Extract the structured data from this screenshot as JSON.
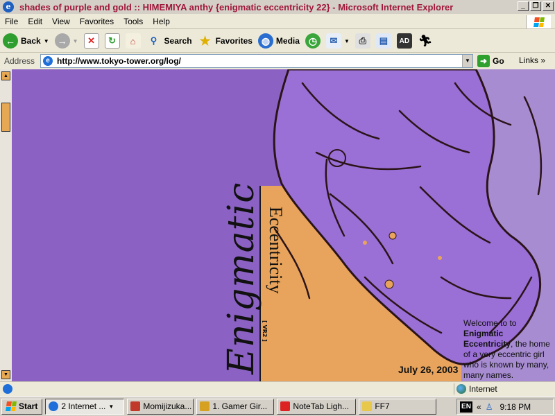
{
  "window": {
    "title": "shades of purple and gold   ::   HIMEMIYA anthy    {enigmatic eccentricity 22} - Microsoft Internet Explorer",
    "controls": [
      "_",
      "❐",
      "✕"
    ]
  },
  "menu": [
    "File",
    "Edit",
    "View",
    "Favorites",
    "Tools",
    "Help"
  ],
  "toolbar": {
    "back_label": "Back",
    "search_label": "Search",
    "favorites_label": "Favorites",
    "media_label": "Media"
  },
  "address": {
    "label": "Address",
    "url": "http://www.tokyo-tower.org/log/",
    "go_label": "Go",
    "links_label": "Links"
  },
  "page": {
    "title_main": "Enigmatic",
    "title_sub": "Eccentricity",
    "version": "[ VR2 ]",
    "date": "July 26, 2003",
    "welcome_intro": "Welcome to to",
    "welcome_name": "Enigmatic Eccentricity",
    "welcome_rest": ", the home of a very eccentric girl who is known by many, many names.",
    "colors": {
      "purple": "#8b62c3",
      "gold": "#e8a45c",
      "lilac": "#a78cd2",
      "title_red": "#a0173a"
    }
  },
  "status": {
    "zone": "Internet"
  },
  "taskbar": {
    "start": "Start",
    "tasks": [
      {
        "label": "2 Internet ...",
        "active": true
      },
      {
        "label": "Momijizuka...",
        "active": false
      },
      {
        "label": "1. Gamer Gir...",
        "active": false
      },
      {
        "label": "NoteTab Ligh...",
        "active": false
      },
      {
        "label": "FF7",
        "active": false
      }
    ],
    "lang": "EN",
    "clock": "9:18 PM"
  }
}
